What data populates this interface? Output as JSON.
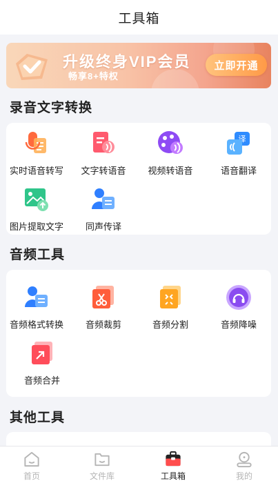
{
  "header": {
    "title": "工具箱"
  },
  "banner": {
    "headline": "升级终身VIP会员",
    "subtitle": "畅享8+特权",
    "cta": "立即开通"
  },
  "sections": [
    {
      "title": "录音文字转换",
      "tools": [
        {
          "label": "实时语音转写",
          "icon": "mic-transcribe-icon"
        },
        {
          "label": "文字转语音",
          "icon": "text-to-speech-icon"
        },
        {
          "label": "视频转语音",
          "icon": "video-to-audio-icon"
        },
        {
          "label": "语音翻译",
          "icon": "voice-translate-icon"
        },
        {
          "label": "图片提取文字",
          "icon": "image-ocr-icon"
        },
        {
          "label": "同声传译",
          "icon": "simultaneous-interpret-icon"
        }
      ]
    },
    {
      "title": "音频工具",
      "tools": [
        {
          "label": "音频格式转换",
          "icon": "audio-format-convert-icon"
        },
        {
          "label": "音频裁剪",
          "icon": "audio-trim-icon"
        },
        {
          "label": "音频分割",
          "icon": "audio-split-icon"
        },
        {
          "label": "音频降噪",
          "icon": "audio-denoise-icon"
        },
        {
          "label": "音频合并",
          "icon": "audio-merge-icon"
        }
      ]
    },
    {
      "title": "其他工具",
      "tools": []
    }
  ],
  "tabbar": {
    "items": [
      {
        "label": "首页",
        "icon": "home-icon",
        "active": false
      },
      {
        "label": "文件库",
        "icon": "folder-icon",
        "active": false
      },
      {
        "label": "工具箱",
        "icon": "toolbox-icon",
        "active": true
      },
      {
        "label": "我的",
        "icon": "profile-icon",
        "active": false
      }
    ]
  },
  "colors": {
    "accent": "#222222",
    "inactive": "#b5b5b5",
    "orange": "#ff8a3d",
    "banner_cta": "#ff9a47"
  }
}
